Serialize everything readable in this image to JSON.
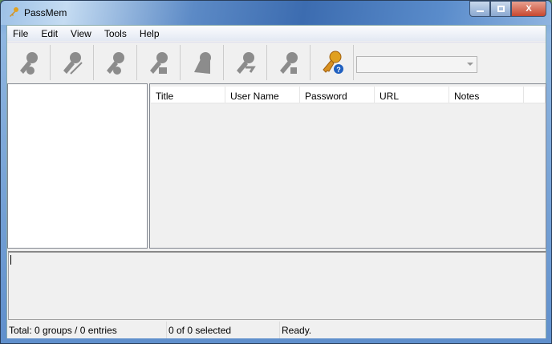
{
  "window": {
    "title": "PassMem",
    "close_label": "X"
  },
  "menu": [
    "File",
    "Edit",
    "View",
    "Tools",
    "Help"
  ],
  "toolbar": {
    "buttons": [
      {
        "name": "add-group",
        "enabled": false
      },
      {
        "name": "edit-group",
        "enabled": false
      },
      {
        "name": "delete-group",
        "enabled": false
      },
      {
        "name": "add-entry",
        "enabled": false
      },
      {
        "name": "edit-entry",
        "enabled": false
      },
      {
        "name": "copy-entry",
        "enabled": false
      },
      {
        "name": "lock-entry",
        "enabled": false
      },
      {
        "name": "help",
        "enabled": true
      }
    ],
    "combo_value": ""
  },
  "list": {
    "columns": [
      "Title",
      "User Name",
      "Password",
      "URL",
      "Notes"
    ]
  },
  "status": {
    "total": "Total: 0 groups / 0 entries",
    "selected": "0 of 0 selected",
    "state": "Ready."
  },
  "colors": {
    "disabled_icon": "#8c8c8c",
    "key_gold": "#e0a020",
    "help_blue": "#2060c0"
  }
}
